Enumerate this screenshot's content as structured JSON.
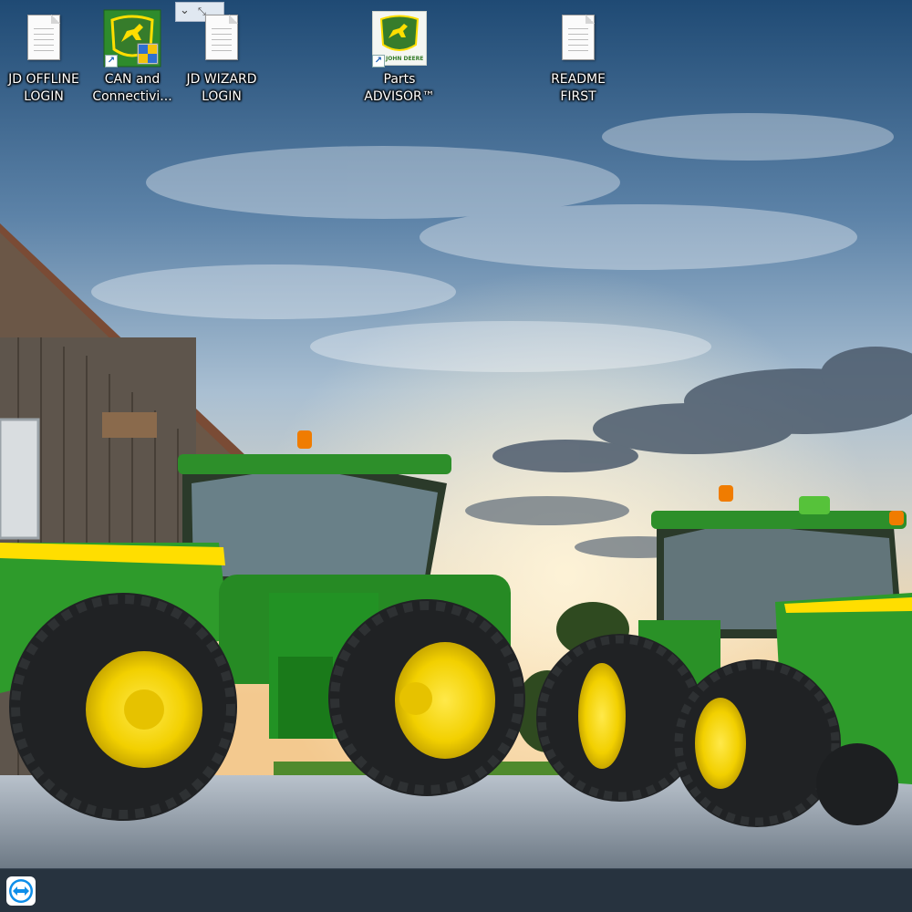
{
  "desktop": {
    "icons": [
      {
        "label": "JD OFFLINE\nLOGIN",
        "icon": "text-document-icon"
      },
      {
        "label": "CAN and\nConnectivi...",
        "icon": "john-deere-can-icon"
      },
      {
        "label": "JD WIZARD\nLOGIN",
        "icon": "text-document-icon"
      },
      {
        "label": "Parts\nADVISOR™",
        "icon": "john-deere-parts-advisor-icon"
      },
      {
        "label": "README\nFIRST",
        "icon": "text-document-icon"
      }
    ],
    "parts_advisor_tile_text": "JOHN DEERE",
    "wallpaper": "John Deere tractors beside a barn at sunset"
  },
  "taskbar": {
    "pinned": [
      {
        "icon": "teamviewer-icon"
      }
    ]
  },
  "colors": {
    "jd_green": "#367c2b",
    "jd_yellow": "#ffde00",
    "taskbar": "#27333f"
  }
}
